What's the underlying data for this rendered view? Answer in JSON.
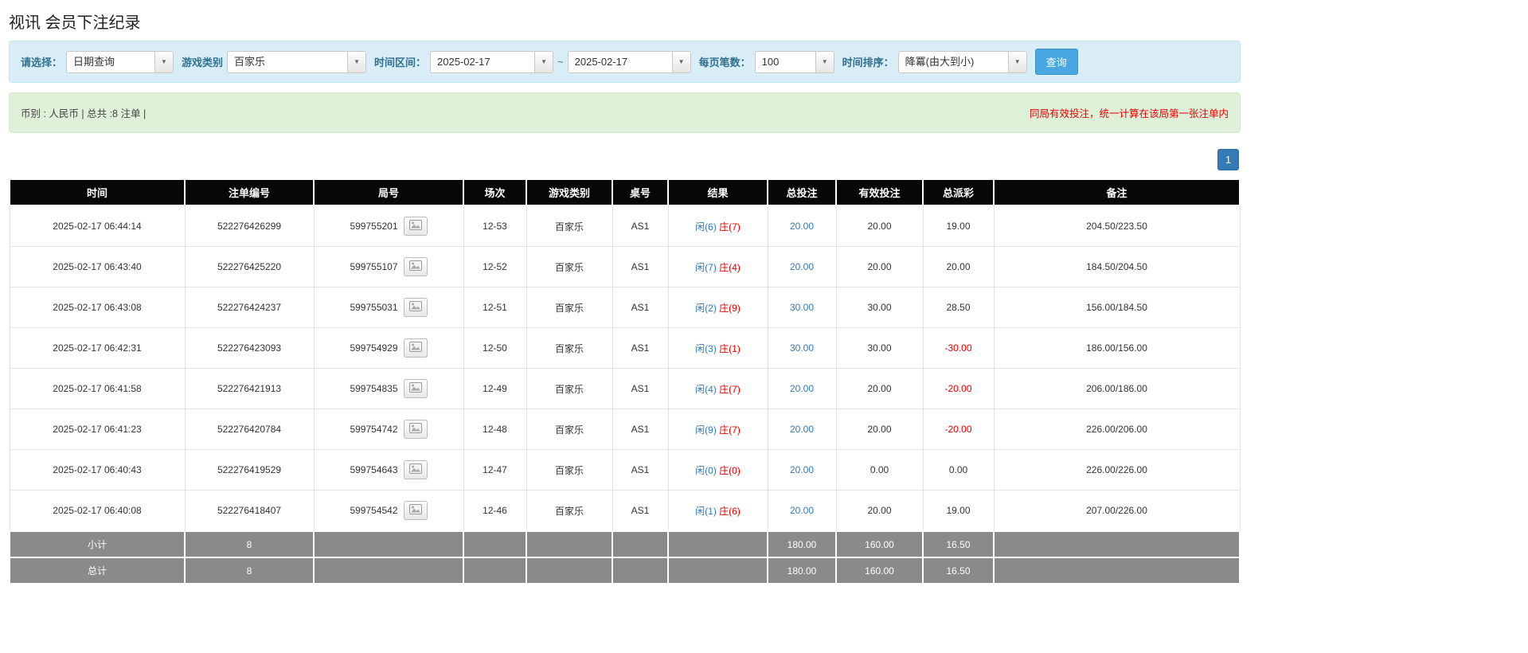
{
  "page": {
    "title": "视讯 会员下注纪录"
  },
  "filters": {
    "select_label": "请选择：",
    "select_value": "日期查询",
    "game_type_label": "游戏类别",
    "game_type_value": "百家乐",
    "date_range_label": "时间区间：",
    "date_from": "2025-02-17",
    "date_separator": "~",
    "date_to": "2025-02-17",
    "page_size_label": "每页笔数：",
    "page_size_value": "100",
    "sort_label": "时间排序：",
    "sort_value": "降冪(由大到小)",
    "search_button": "查询",
    "chevron_icon": "▼"
  },
  "summary": {
    "left": "币别 : 人民币 | 总共 :8 注单 |",
    "right": "同局有效投注，统一计算在该局第一张注单内"
  },
  "pagination": {
    "current": "1"
  },
  "table": {
    "headers": [
      "时间",
      "注单编号",
      "局号",
      "场次",
      "游戏类别",
      "桌号",
      "结果",
      "总投注",
      "有效投注",
      "总派彩",
      "备注"
    ],
    "rows": [
      {
        "time": "2025-02-17 06:44:14",
        "bet_id": "522276426299",
        "round_id": "599755201",
        "session": "12-53",
        "game": "百家乐",
        "table_no": "AS1",
        "result_player": "闲(6)",
        "result_banker": "庄(7)",
        "total_bet": "20.00",
        "valid_bet": "20.00",
        "payout": "19.00",
        "remark": "204.50/223.50"
      },
      {
        "time": "2025-02-17 06:43:40",
        "bet_id": "522276425220",
        "round_id": "599755107",
        "session": "12-52",
        "game": "百家乐",
        "table_no": "AS1",
        "result_player": "闲(7)",
        "result_banker": "庄(4)",
        "total_bet": "20.00",
        "valid_bet": "20.00",
        "payout": "20.00",
        "remark": "184.50/204.50"
      },
      {
        "time": "2025-02-17 06:43:08",
        "bet_id": "522276424237",
        "round_id": "599755031",
        "session": "12-51",
        "game": "百家乐",
        "table_no": "AS1",
        "result_player": "闲(2)",
        "result_banker": "庄(9)",
        "total_bet": "30.00",
        "valid_bet": "30.00",
        "payout": "28.50",
        "remark": "156.00/184.50"
      },
      {
        "time": "2025-02-17 06:42:31",
        "bet_id": "522276423093",
        "round_id": "599754929",
        "session": "12-50",
        "game": "百家乐",
        "table_no": "AS1",
        "result_player": "闲(3)",
        "result_banker": "庄(1)",
        "total_bet": "30.00",
        "valid_bet": "30.00",
        "payout": "-30.00",
        "remark": "186.00/156.00"
      },
      {
        "time": "2025-02-17 06:41:58",
        "bet_id": "522276421913",
        "round_id": "599754835",
        "session": "12-49",
        "game": "百家乐",
        "table_no": "AS1",
        "result_player": "闲(4)",
        "result_banker": "庄(7)",
        "total_bet": "20.00",
        "valid_bet": "20.00",
        "payout": "-20.00",
        "remark": "206.00/186.00"
      },
      {
        "time": "2025-02-17 06:41:23",
        "bet_id": "522276420784",
        "round_id": "599754742",
        "session": "12-48",
        "game": "百家乐",
        "table_no": "AS1",
        "result_player": "闲(9)",
        "result_banker": "庄(7)",
        "total_bet": "20.00",
        "valid_bet": "20.00",
        "payout": "-20.00",
        "remark": "226.00/206.00"
      },
      {
        "time": "2025-02-17 06:40:43",
        "bet_id": "522276419529",
        "round_id": "599754643",
        "session": "12-47",
        "game": "百家乐",
        "table_no": "AS1",
        "result_player": "闲(0)",
        "result_banker": "庄(0)",
        "total_bet": "20.00",
        "valid_bet": "0.00",
        "payout": "0.00",
        "remark": "226.00/226.00"
      },
      {
        "time": "2025-02-17 06:40:08",
        "bet_id": "522276418407",
        "round_id": "599754542",
        "session": "12-46",
        "game": "百家乐",
        "table_no": "AS1",
        "result_player": "闲(1)",
        "result_banker": "庄(6)",
        "total_bet": "20.00",
        "valid_bet": "20.00",
        "payout": "19.00",
        "remark": "207.00/226.00"
      }
    ],
    "subtotal": {
      "label": "小计",
      "count": "8",
      "total_bet": "180.00",
      "valid_bet": "160.00",
      "payout": "16.50"
    },
    "total": {
      "label": "总计",
      "count": "8",
      "total_bet": "180.00",
      "valid_bet": "160.00",
      "payout": "16.50"
    }
  }
}
